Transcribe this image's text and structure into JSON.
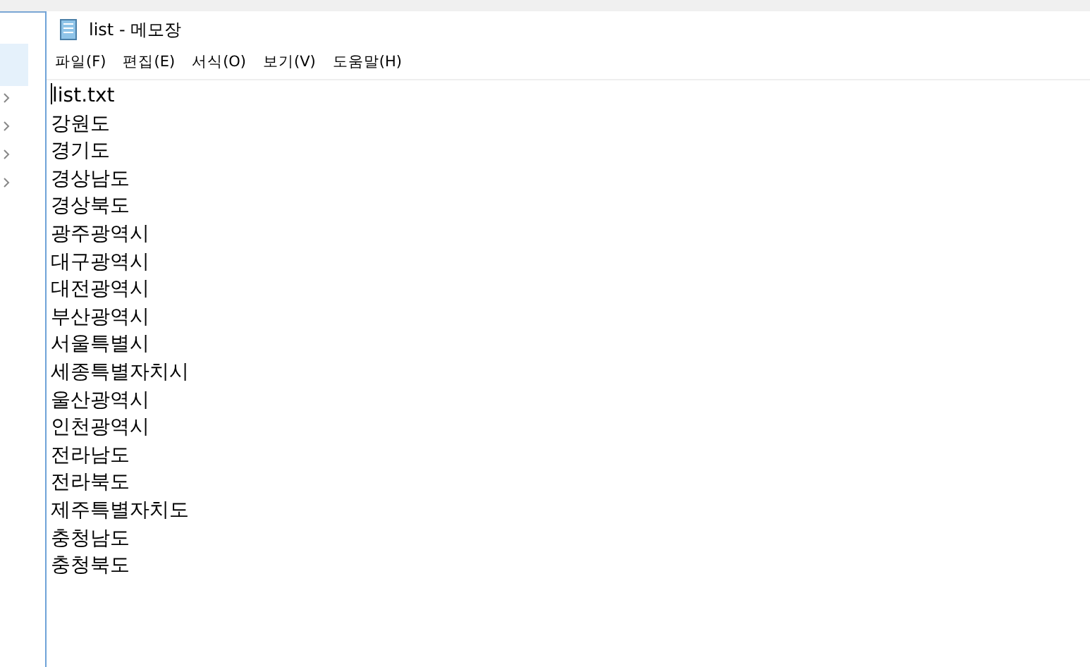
{
  "window": {
    "title": "list - 메모장"
  },
  "menu": [
    "파일(F)",
    "편집(E)",
    "서식(O)",
    "보기(V)",
    "도움말(H)"
  ],
  "lines": [
    "list.txt",
    "강원도",
    "경기도",
    "경상남도",
    "경상북도",
    "광주광역시",
    "대구광역시",
    "대전광역시",
    "부산광역시",
    "서울특별시",
    "세종특별자치시",
    "울산광역시",
    "인천광역시",
    "전라남도",
    "전라북도",
    "제주특별자치도",
    "충청남도",
    "충청북도"
  ]
}
